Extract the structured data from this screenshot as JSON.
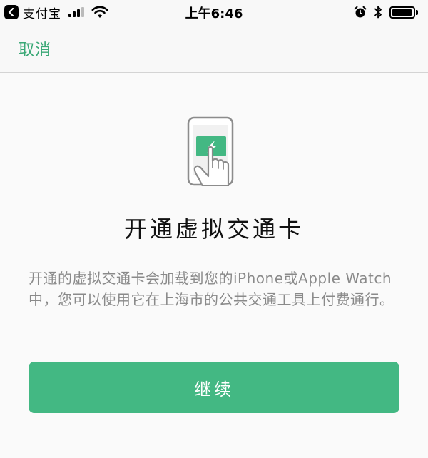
{
  "status_bar": {
    "back_app": "支付宝",
    "time": "上午6:46",
    "battery_level": 0.95
  },
  "nav": {
    "cancel_label": "取消"
  },
  "main": {
    "title": "开通虚拟交通卡",
    "description": "开通的虚拟交通卡会加载到您的iPhone或Apple Watch中，您可以使用它在上海市的公共交通工具上付费通行。",
    "continue_label": "继续"
  },
  "colors": {
    "accent": "#43b883",
    "cancel_text": "#3aa876",
    "description_text": "#8a8a8a"
  },
  "icons": {
    "back": "back-app-icon",
    "signal": "signal-icon",
    "wifi": "wifi-icon",
    "alarm": "alarm-icon",
    "bluetooth": "bluetooth-icon",
    "battery": "battery-icon",
    "illustration": "phone-tap-card-icon"
  }
}
